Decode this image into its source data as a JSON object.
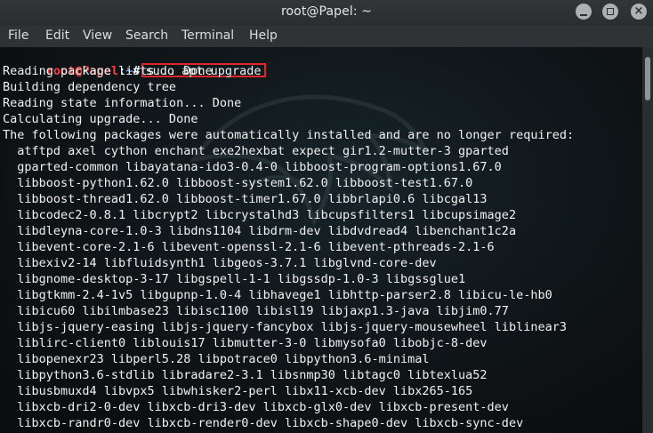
{
  "window": {
    "title": "root@Papel: ~",
    "buttons": {
      "minimize": "minimize-icon",
      "maximize": "maximize-icon",
      "close": "close-icon",
      "close_glyph": "×"
    }
  },
  "menu": {
    "items": [
      "File",
      "Edit",
      "View",
      "Search",
      "Terminal",
      "Help"
    ]
  },
  "terminal": {
    "prompt": {
      "user_host": "root@Papel",
      "separator": ":",
      "path": "~",
      "symbol": "#"
    },
    "command": "sudo apt upgrade",
    "output": [
      "Reading package lists... Done",
      "Building dependency tree",
      "Reading state information... Done",
      "Calculating upgrade... Done",
      "The following packages were automatically installed and are no longer required:",
      "  atftpd axel cython enchant exe2hexbat expect gir1.2-mutter-3 gparted",
      "  gparted-common libayatana-ido3-0.4-0 libboost-program-options1.67.0",
      "  libboost-python1.62.0 libboost-system1.62.0 libboost-test1.67.0",
      "  libboost-thread1.62.0 libboost-timer1.67.0 libbrlapi0.6 libcgal13",
      "  libcodec2-0.8.1 libcrypt2 libcrystalhd3 libcupsfilters1 libcupsimage2",
      "  libdleyna-core-1.0-3 libdns1104 libdrm-dev libdvdread4 libenchant1c2a",
      "  libevent-core-2.1-6 libevent-openssl-2.1-6 libevent-pthreads-2.1-6",
      "  libexiv2-14 libfluidsynth1 libgeos-3.7.1 libglvnd-core-dev",
      "  libgnome-desktop-3-17 libgspell-1-1 libgssdp-1.0-3 libgssglue1",
      "  libgtkmm-2.4-1v5 libgupnp-1.0-4 libhavege1 libhttp-parser2.8 libicu-le-hb0",
      "  libicu60 libilmbase23 libisc1100 libisl19 libjaxp1.3-java libjim0.77",
      "  libjs-jquery-easing libjs-jquery-fancybox libjs-jquery-mousewheel liblinear3",
      "  liblirc-client0 liblouis17 libmutter-3-0 libmysofa0 libobjc-8-dev",
      "  libopenexr23 libperl5.28 libpotrace0 libpython3.6-minimal",
      "  libpython3.6-stdlib libradare2-3.1 libsnmp30 libtagc0 libtexlua52",
      "  libusbmuxd4 libvpx5 libwhisker2-perl libx11-xcb-dev libx265-165",
      "  libxcb-dri2-0-dev libxcb-dri3-dev libxcb-glx0-dev libxcb-present-dev",
      "  libxcb-randr0-dev libxcb-render0-dev libxcb-shape0-dev libxcb-sync-dev"
    ]
  },
  "scrollbar": {
    "position": 0.0
  },
  "colors": {
    "background": "#0f1416",
    "text": "#f1f1f1",
    "prompt_user": "#ff3b3b",
    "prompt_path": "#6fa7ff",
    "highlight_box": "#e1252a"
  }
}
